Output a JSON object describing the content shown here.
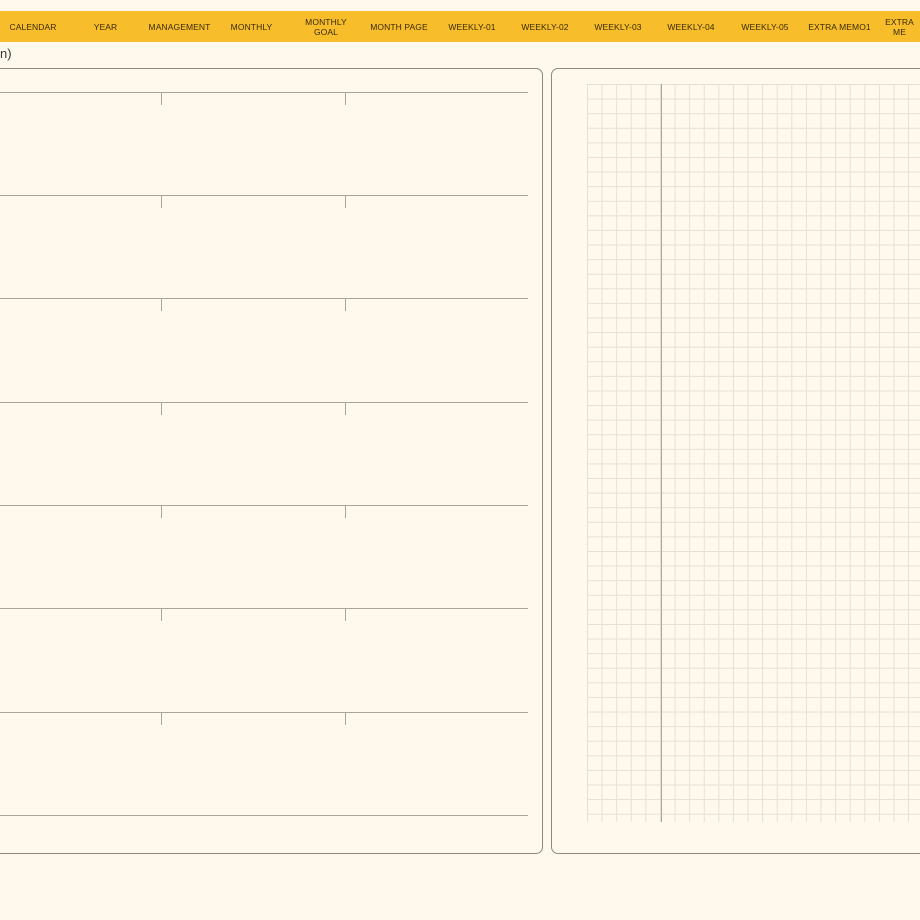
{
  "nav": {
    "tabs": [
      {
        "label": "CALENDAR"
      },
      {
        "label": "YEAR"
      },
      {
        "label": "MANAGEMENT"
      },
      {
        "label": "MONTHLY"
      },
      {
        "label": "MONTHLY\nGOAL"
      },
      {
        "label": "MONTH PAGE"
      },
      {
        "label": "WEEKLY-01"
      },
      {
        "label": "WEEKLY-02"
      },
      {
        "label": "WEEKLY-03"
      },
      {
        "label": "WEEKLY-04"
      },
      {
        "label": "WEEKLY-05"
      },
      {
        "label": "EXTRA MEMO1"
      },
      {
        "label": "EXTRA ME"
      }
    ],
    "accent_color": "#f7bd2b"
  },
  "page": {
    "stub_text": "n)",
    "background_color": "#fff8ec"
  }
}
